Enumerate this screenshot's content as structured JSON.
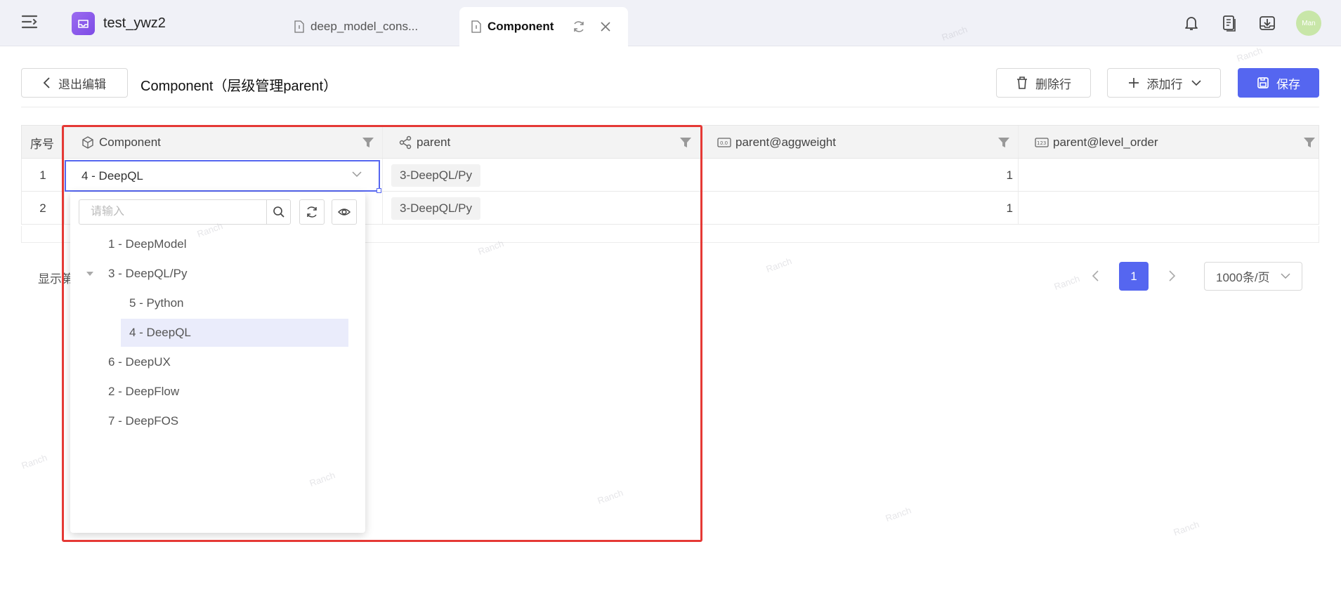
{
  "header": {
    "app_name": "test_ywz2",
    "tabs": [
      {
        "label": "deep_model_cons..."
      },
      {
        "label": "Component"
      }
    ],
    "avatar_text": "Man",
    "colors": {
      "accent": "#5566f0",
      "app_logo": "#8a5ae8",
      "avatar": "#c8e6a8"
    }
  },
  "toolbar": {
    "exit_label": "退出编辑",
    "page_title": "Component（层级管理parent）",
    "delete_label": "删除行",
    "add_label": "添加行",
    "save_label": "保存"
  },
  "table": {
    "columns": [
      {
        "label": "序号"
      },
      {
        "label": "Component"
      },
      {
        "label": "parent"
      },
      {
        "label": "parent@aggweight"
      },
      {
        "label": "parent@level_order"
      }
    ],
    "rows": [
      {
        "index": "1",
        "component": "4 - DeepQL",
        "parent": "3-DeepQL/Py",
        "aggweight": "1",
        "level_order": ""
      },
      {
        "index": "2",
        "component": "",
        "parent": "3-DeepQL/Py",
        "aggweight": "1",
        "level_order": ""
      }
    ]
  },
  "dropdown": {
    "search_placeholder": "请输入",
    "items": [
      {
        "label": "1 - DeepModel"
      },
      {
        "label": "3 - DeepQL/Py"
      },
      {
        "label": "5 - Python"
      },
      {
        "label": "4 - DeepQL"
      },
      {
        "label": "6 - DeepUX"
      },
      {
        "label": "2 - DeepFlow"
      },
      {
        "label": "7 - DeepFOS"
      }
    ],
    "selected": "4 - DeepQL"
  },
  "pagination": {
    "show_label": "显示第",
    "current_page": "1",
    "page_size": "1000条/页"
  },
  "watermark_text": "Ranch"
}
